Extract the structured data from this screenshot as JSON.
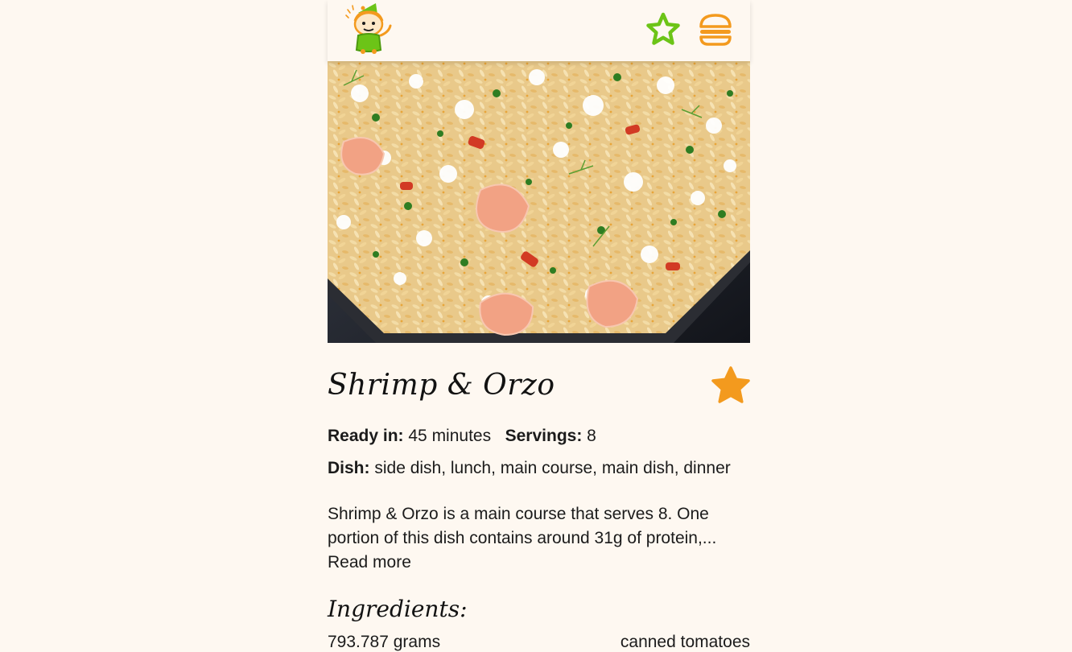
{
  "colors": {
    "background": "#fef8f1",
    "accent_orange": "#f39a1e",
    "accent_green": "#6cc417",
    "text": "#1b1b1b"
  },
  "header": {
    "logo_icon": "chef-mascot-icon",
    "favorites_icon": "star-outline-icon",
    "menu_icon": "burger-menu-icon"
  },
  "recipe": {
    "title": "Shrimp & Orzo",
    "favorite_icon": "star-filled-icon",
    "ready_label": "Ready in:",
    "ready_value": "45 minutes",
    "servings_label": "Servings:",
    "servings_value": "8",
    "dish_label": "Dish:",
    "dish_value": "side dish, lunch, main course, main dish, dinner",
    "summary": "Shrimp & Orzo is a main course that serves 8. One portion of this dish contains around 31g of protein,...",
    "read_more": "Read more"
  },
  "ingredients": {
    "heading": "Ingredients:",
    "items": [
      "793.787 grams",
      "canned tomatoes"
    ]
  }
}
